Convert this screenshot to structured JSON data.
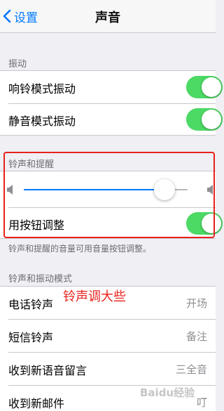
{
  "navbar": {
    "back_label": "设置",
    "title": "声音"
  },
  "vibrate": {
    "header": "振动",
    "items": [
      {
        "label": "响铃模式振动",
        "on": true
      },
      {
        "label": "静音模式振动",
        "on": true
      }
    ]
  },
  "ringer": {
    "header": "铃声和提醒",
    "volume_level": 0.86,
    "change_with_buttons": {
      "label": "用按钮调整",
      "on": true
    },
    "footer": "铃声和提醒的音量可用音量按钮调整。"
  },
  "patterns": {
    "header": "铃声和振动模式",
    "items": [
      {
        "label": "电话铃声",
        "value": "开场"
      },
      {
        "label": "短信铃声",
        "value": "备注"
      },
      {
        "label": "收到新语音留言",
        "value": "三全音"
      },
      {
        "label": "收到新邮件",
        "value": "叮"
      }
    ]
  },
  "annotation": "铃声调大些",
  "watermark": "Baidu经验",
  "colors": {
    "accent": "#007aff",
    "toggle_on": "#4cd964",
    "annotation_red": "#e8211c"
  }
}
